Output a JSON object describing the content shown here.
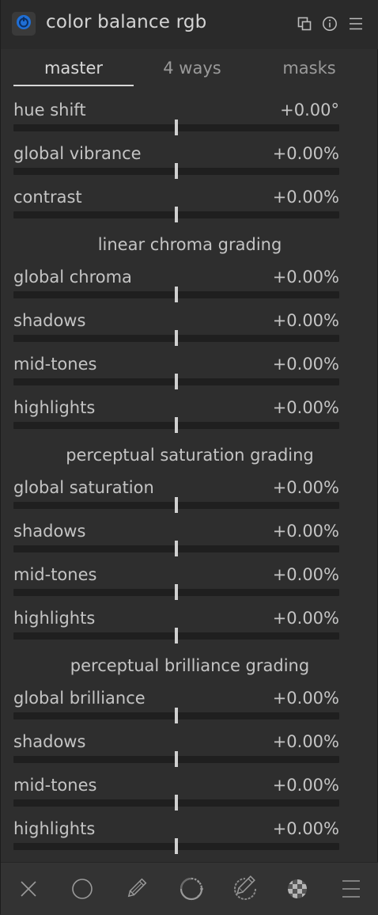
{
  "header": {
    "title": "color balance rgb",
    "power_icon": "power-icon",
    "icons": [
      "multi-instance-icon",
      "reset-icon",
      "presets-menu-icon"
    ],
    "accent": "#1f6fd6"
  },
  "tabs": [
    {
      "label": "master",
      "active": true
    },
    {
      "label": "4 ways",
      "active": false
    },
    {
      "label": "masks",
      "active": false
    }
  ],
  "master": {
    "rows_top": [
      {
        "label": "hue shift",
        "value": "+0.00°",
        "level": 0.5
      },
      {
        "label": "global vibrance",
        "value": "+0.00%",
        "level": 0.5
      },
      {
        "label": "contrast",
        "value": "+0.00%",
        "level": 0.5
      }
    ],
    "sections": [
      {
        "title": "linear chroma grading",
        "rows": [
          {
            "label": "global chroma",
            "value": "+0.00%",
            "level": 0.5
          },
          {
            "label": "shadows",
            "value": "+0.00%",
            "level": 0.5
          },
          {
            "label": "mid-tones",
            "value": "+0.00%",
            "level": 0.5
          },
          {
            "label": "highlights",
            "value": "+0.00%",
            "level": 0.5
          }
        ]
      },
      {
        "title": "perceptual saturation grading",
        "rows": [
          {
            "label": "global saturation",
            "value": "+0.00%",
            "level": 0.5
          },
          {
            "label": "shadows",
            "value": "+0.00%",
            "level": 0.5
          },
          {
            "label": "mid-tones",
            "value": "+0.00%",
            "level": 0.5
          },
          {
            "label": "highlights",
            "value": "+0.00%",
            "level": 0.5
          }
        ]
      },
      {
        "title": "perceptual brilliance grading",
        "rows": [
          {
            "label": "global brilliance",
            "value": "+0.00%",
            "level": 0.5
          },
          {
            "label": "shadows",
            "value": "+0.00%",
            "level": 0.5
          },
          {
            "label": "mid-tones",
            "value": "+0.00%",
            "level": 0.5
          },
          {
            "label": "highlights",
            "value": "+0.00%",
            "level": 0.5
          }
        ]
      }
    ]
  },
  "toolbar": {
    "items": [
      "blend-off-icon",
      "uniform-blend-icon",
      "drawn-mask-icon",
      "parametric-mask-icon",
      "drawn-parametric-mask-icon",
      "raster-mask-icon",
      "blend-options-menu-icon"
    ]
  }
}
